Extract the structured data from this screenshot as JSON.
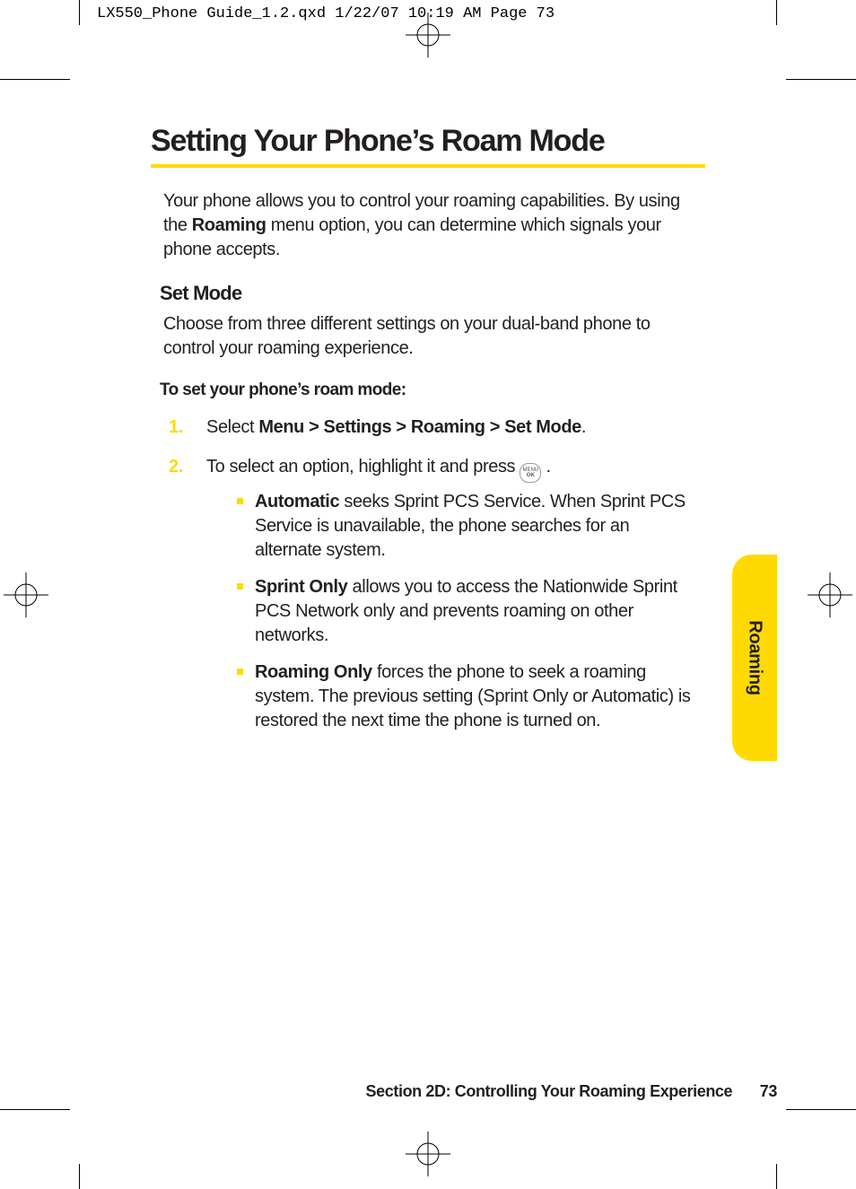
{
  "slug": "LX550_Phone Guide_1.2.qxd  1/22/07  10:19 AM  Page 73",
  "colors": {
    "accent": "#ffda00"
  },
  "tab_label": "Roaming",
  "title": "Setting Your Phone’s Roam Mode",
  "intro_pre": "Your phone allows you to control your roaming capabilities. By using the ",
  "intro_bold": "Roaming",
  "intro_post": " menu option, you can determine which signals your phone accepts.",
  "h2": "Set Mode",
  "para2": "Choose from three different settings on your dual-band phone to control your roaming experience.",
  "lead": "To set your phone’s roam mode:",
  "step1_num": "1.",
  "step1_pre": "Select ",
  "step1_bold": "Menu > Settings > Roaming > Set Mode",
  "step1_post": ".",
  "step2_num": "2.",
  "step2_pre": "To select an option, highlight it and press ",
  "step2_post": " .",
  "bul1_b": "Automatic",
  "bul1_t": " seeks Sprint PCS Service. When Sprint PCS Service is unavailable, the phone searches for an alternate system.",
  "bul2_b": "Sprint Only",
  "bul2_t": " allows you to access the Nationwide Sprint PCS Network only and prevents roaming on other networks.",
  "bul3_b": "Roaming Only",
  "bul3_t": " forces the phone to seek a roaming system. The previous setting (Sprint Only or Automatic) is restored the next time the phone is turned on.",
  "footer_section": "Section 2D: Controlling Your Roaming Experience",
  "footer_page": "73"
}
